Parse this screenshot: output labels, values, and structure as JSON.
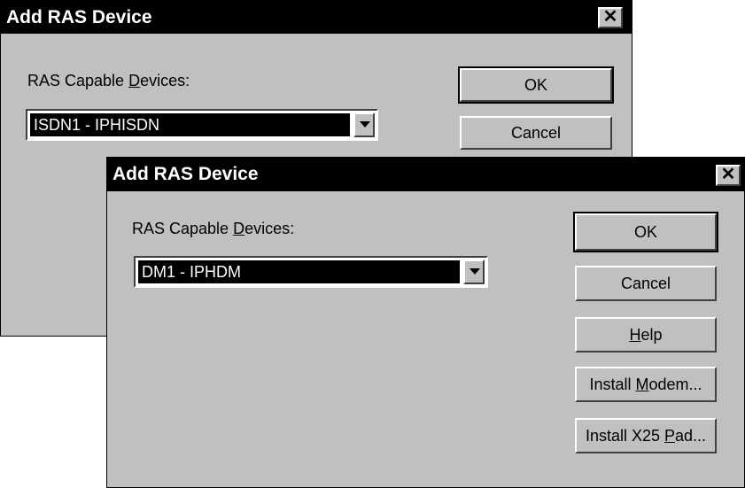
{
  "back_dialog": {
    "title": "Add RAS Device",
    "close_label": "✕",
    "label_before": "RAS Capable ",
    "label_mnemonic": "D",
    "label_after": "evices:",
    "device_value": "ISDN1 - IPHISDN",
    "ok_label": "OK",
    "cancel_label": "Cancel"
  },
  "front_dialog": {
    "title": "Add RAS Device",
    "close_label": "✕",
    "label_before": "RAS Capable ",
    "label_mnemonic": "D",
    "label_after": "evices:",
    "device_value": "DM1 - IPHDM",
    "ok_label": "OK",
    "cancel_label": "Cancel",
    "help_mnemonic": "H",
    "help_after": "elp",
    "install_modem_before": "Install ",
    "install_modem_mnemonic": "M",
    "install_modem_after": "odem...",
    "install_x25_before": "Install X25 ",
    "install_x25_mnemonic": "P",
    "install_x25_after": "ad..."
  }
}
